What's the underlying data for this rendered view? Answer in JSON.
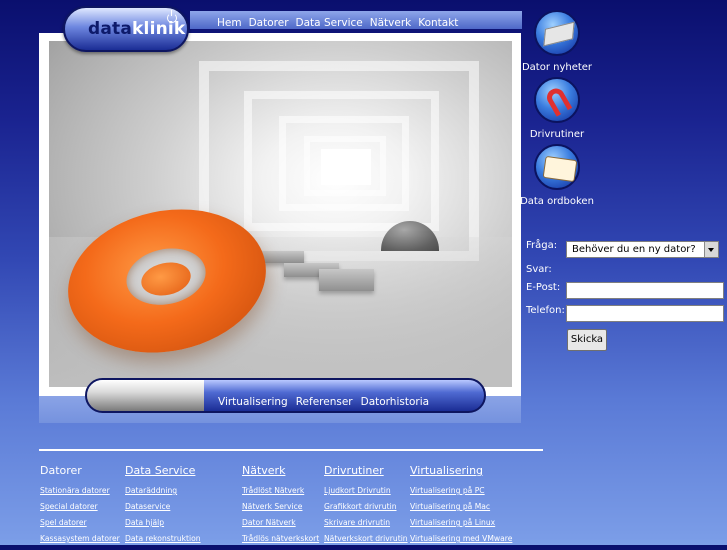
{
  "logo": {
    "part1": "data",
    "part2": "klinik"
  },
  "topnav": [
    "Hem",
    "Datorer",
    "Data Service",
    "Nätverk",
    "Kontakt"
  ],
  "subnav": [
    "Virtualisering",
    "Referenser",
    "Datorhistoria"
  ],
  "sidebar": {
    "items": [
      {
        "label": "Dator nyheter",
        "icon": "motherboard-icon"
      },
      {
        "label": "Drivrutiner",
        "icon": "candy-cane-icon"
      },
      {
        "label": "Data ordboken",
        "icon": "book-icon"
      }
    ]
  },
  "form": {
    "question_label": "Fråga:",
    "question_value": "Behöver du en ny dator?",
    "answer_label": "Svar:",
    "email_label": "E-Post:",
    "email_value": "",
    "phone_label": "Telefon:",
    "phone_value": "",
    "submit_label": "Skicka"
  },
  "footer": {
    "columns": [
      {
        "heading": "Datorer",
        "heading_link": false,
        "links": [
          "Stationära datorer",
          "Special datorer",
          "Spel datorer",
          "Kassasystem datorer"
        ]
      },
      {
        "heading": "Data Service",
        "heading_link": true,
        "links": [
          "Dataräddning",
          "Dataservice",
          "Data hjälp",
          "Data rekonstruktion"
        ]
      },
      {
        "heading": "Nätverk",
        "heading_link": true,
        "links": [
          "Trådlöst Nätverk",
          "Nätverk Service",
          "Dator Nätverk",
          "Trådlös nätverkskort"
        ]
      },
      {
        "heading": "Drivrutiner",
        "heading_link": true,
        "links": [
          "Ljudkort Drivrutin",
          "Grafikkort drivrutin",
          "Skrivare drivrutin",
          "Nätverkskort drivrutin"
        ]
      },
      {
        "heading": "Virtualisering",
        "heading_link": true,
        "links": [
          "Virtualisering på PC",
          "Virtualisering på Mac",
          "Virtualisering på Linux",
          "Virtualisering med VMware"
        ]
      }
    ]
  },
  "colors": {
    "bg_top": "#0a0f6e",
    "bg_bottom": "#7c9ee8",
    "accent_orange": "#f46a1a"
  }
}
